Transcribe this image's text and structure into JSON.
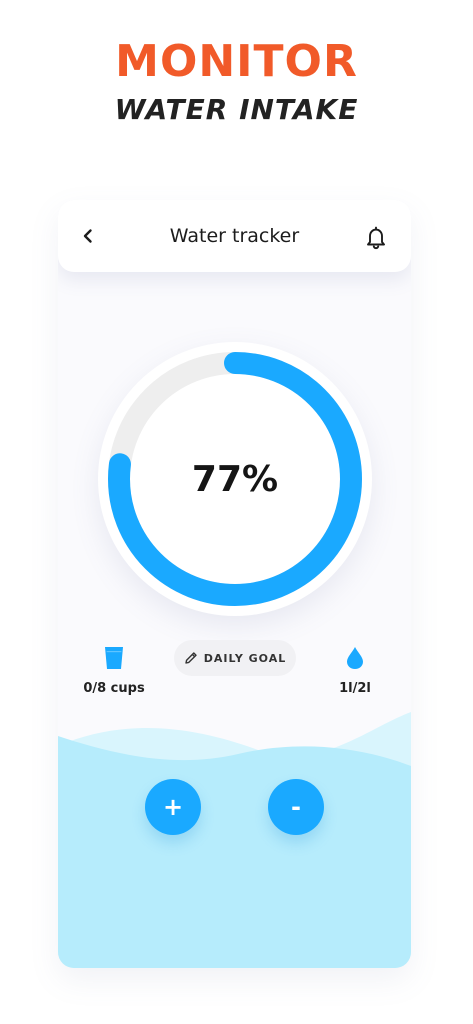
{
  "promo": {
    "title": "MONITOR",
    "subtitle": "WATER INTAKE"
  },
  "header": {
    "title": "Water tracker",
    "back_icon": "chevron-left-icon",
    "notification_icon": "bell-icon"
  },
  "progress": {
    "percent_label": "77%",
    "fraction": 0.77,
    "track_color": "#eeeeee",
    "fill_color": "#1aa9ff"
  },
  "stats": {
    "cups": {
      "icon": "cup-icon",
      "label": "0/8 cups"
    },
    "daily_goal": {
      "icon": "pencil-icon",
      "label": "DAILY GOAL"
    },
    "volume": {
      "icon": "water-drop-icon",
      "label": "1l/2l"
    }
  },
  "controls": {
    "add_label": "+",
    "remove_label": "-"
  },
  "colors": {
    "brand_orange": "#f15a29",
    "accent_blue": "#1aa9ff",
    "wave_light": "#b6ecfc",
    "wave_lighter": "#d9f5fd"
  }
}
